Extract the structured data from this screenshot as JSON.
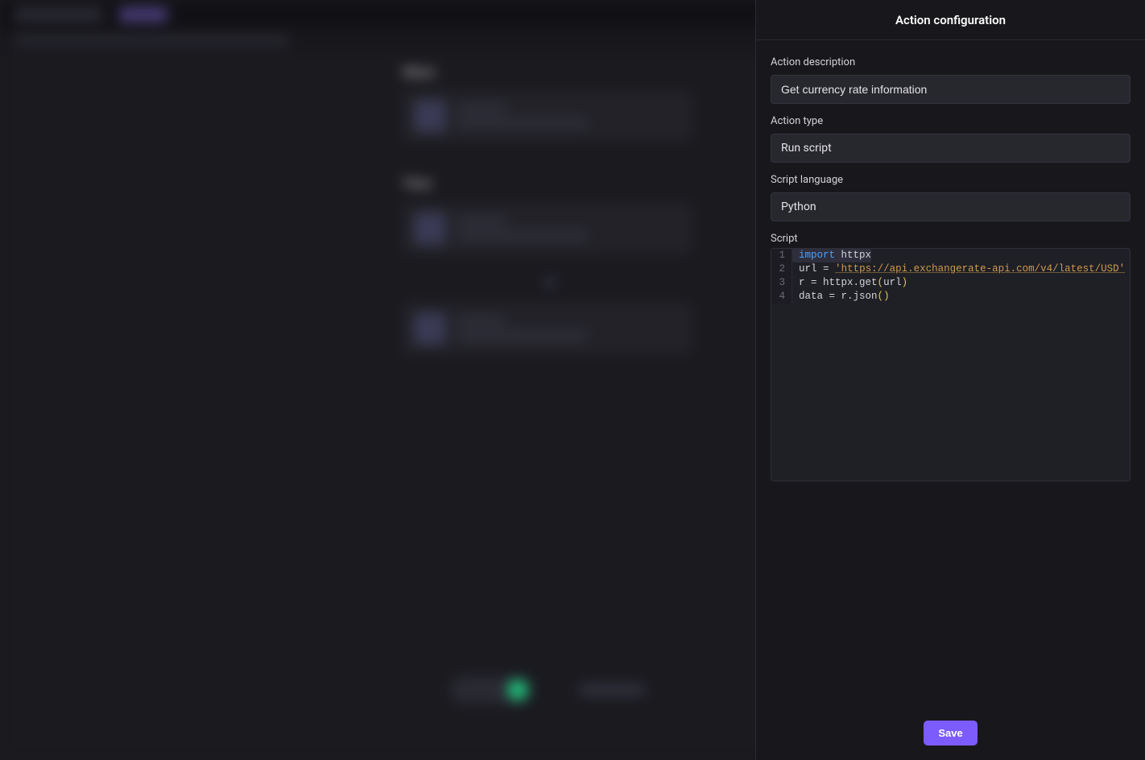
{
  "panel": {
    "title": "Action configuration",
    "fields": {
      "description_label": "Action description",
      "description_value": "Get currency rate information",
      "type_label": "Action type",
      "type_value": "Run script",
      "language_label": "Script language",
      "language_value": "Python",
      "script_label": "Script"
    },
    "code": {
      "lines": [
        {
          "n": "1",
          "tokens": [
            {
              "t": "import",
              "c": "kw"
            },
            {
              "t": " ",
              "c": "id"
            },
            {
              "t": "httpx",
              "c": "id"
            }
          ]
        },
        {
          "n": "2",
          "tokens": [
            {
              "t": "url ",
              "c": "id"
            },
            {
              "t": "=",
              "c": "id"
            },
            {
              "t": " ",
              "c": "id"
            },
            {
              "t": "'",
              "c": "str"
            },
            {
              "t": "https://api.exchangerate-api.com/v4/latest/USD",
              "c": "str"
            },
            {
              "t": "'",
              "c": "str"
            }
          ]
        },
        {
          "n": "3",
          "tokens": [
            {
              "t": "r ",
              "c": "id"
            },
            {
              "t": "=",
              "c": "id"
            },
            {
              "t": " httpx.get",
              "c": "id"
            },
            {
              "t": "(",
              "c": "pn"
            },
            {
              "t": "url",
              "c": "id"
            },
            {
              "t": ")",
              "c": "pn"
            }
          ]
        },
        {
          "n": "4",
          "tokens": [
            {
              "t": "data ",
              "c": "id"
            },
            {
              "t": "=",
              "c": "id"
            },
            {
              "t": " r.json",
              "c": "id"
            },
            {
              "t": "(",
              "c": "pn"
            },
            {
              "t": ")",
              "c": "pn"
            }
          ]
        }
      ]
    },
    "save_label": "Save"
  },
  "background": {
    "section1_label": "When",
    "section2_label": "Then"
  }
}
